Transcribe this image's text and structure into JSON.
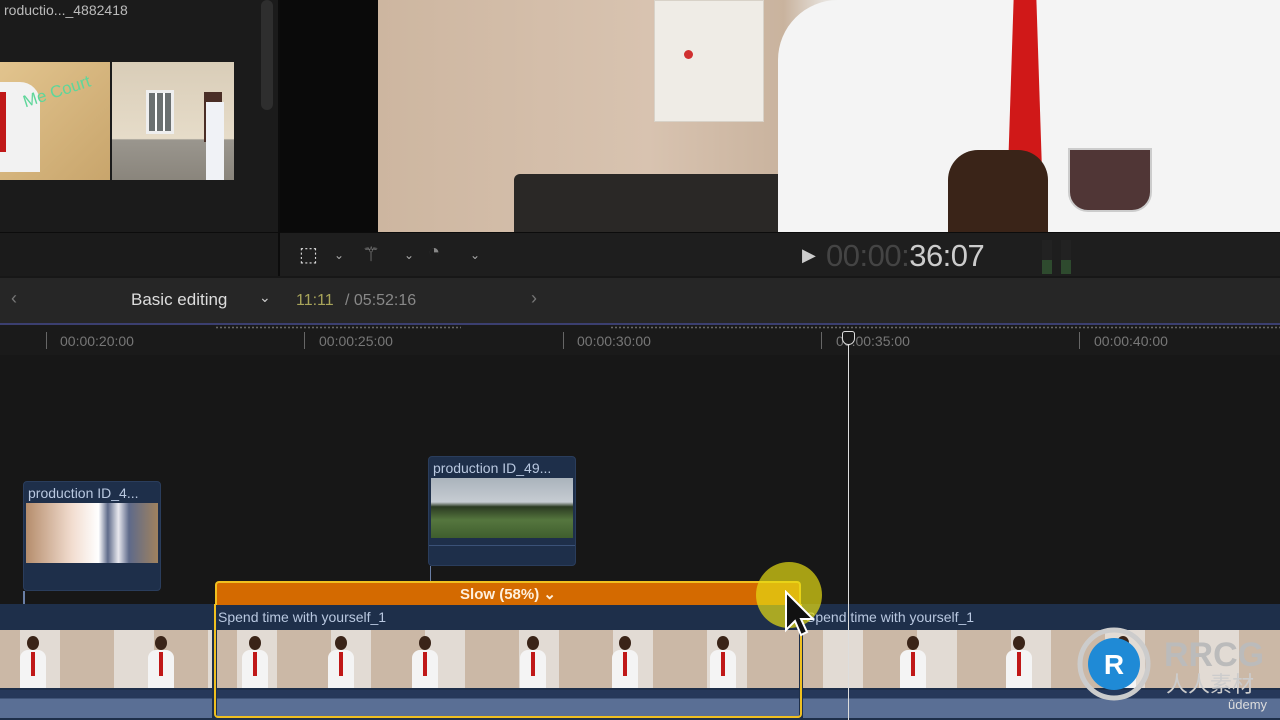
{
  "browser": {
    "partial_title": "roductio..._4882418"
  },
  "viewer_toolbar": {
    "icons": [
      "transform-icon",
      "enhance-wand-icon",
      "retime-speed-icon"
    ],
    "timecode_dim": "00:00:",
    "timecode": "36:07"
  },
  "timeline_header": {
    "project": "Basic editing",
    "position": "11:11",
    "duration": "/ 05:52:16"
  },
  "ruler": {
    "labels": [
      "00:00:20:00",
      "00:00:25:00",
      "00:00:30:00",
      "00:00:35:00",
      "00:00:40:00"
    ]
  },
  "connected_clips": [
    {
      "name": "production ID_4..."
    },
    {
      "name": "production ID_49..."
    }
  ],
  "storyline": {
    "clip_name": "Spend time with yourself_1",
    "next_clip_name": "Spend time with yourself_1",
    "retime_label": "Slow (58%)"
  },
  "colors": {
    "accent_orange": "#d46a00",
    "selection": "#f0c020",
    "clip_blue": "#1e2f4a"
  },
  "watermark": {
    "text": "RRCG",
    "subtext": "人人素材",
    "udemy": "ûdemy"
  }
}
